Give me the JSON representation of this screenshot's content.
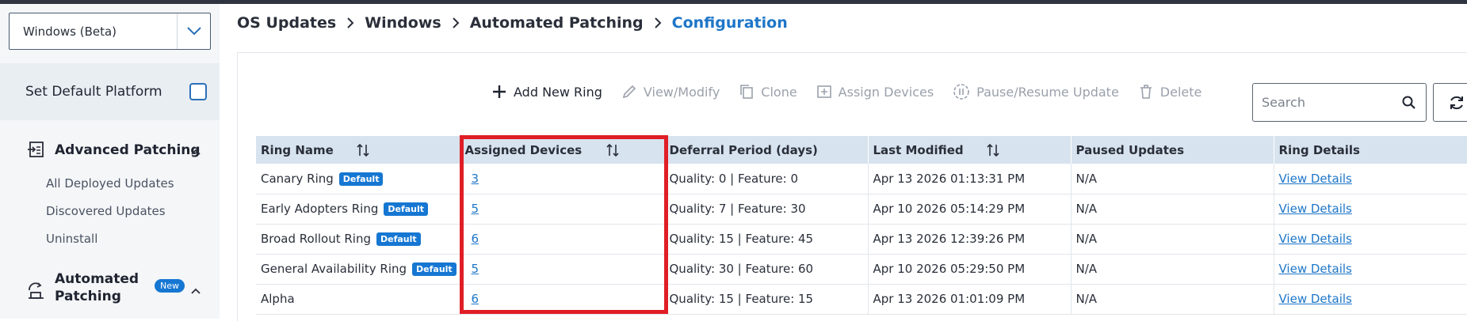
{
  "sidebar": {
    "platform_select": "Windows (Beta)",
    "default_platform_label": "Set Default Platform",
    "advanced": {
      "title": "Advanced Patching",
      "items": [
        "All Deployed Updates",
        "Discovered Updates",
        "Uninstall"
      ]
    },
    "automated": {
      "title_line1": "Automated",
      "title_line2": "Patching",
      "badge": "New"
    }
  },
  "breadcrumb": [
    "OS Updates",
    "Windows",
    "Automated Patching",
    "Configuration"
  ],
  "toolbar": {
    "add": "Add New Ring",
    "view": "View/Modify",
    "clone": "Clone",
    "assign": "Assign Devices",
    "pause": "Pause/Resume Update",
    "delete": "Delete",
    "search_placeholder": "Search"
  },
  "table": {
    "headers": [
      "Ring Name",
      "Assigned Devices",
      "Deferral Period (days)",
      "Last Modified",
      "Paused Updates",
      "Ring Details"
    ],
    "default_badge": "Default",
    "rows": [
      {
        "name": "Canary Ring",
        "devices": "3",
        "deferral": "Quality: 0 | Feature: 0",
        "modified": "Apr 13 2026 01:13:31 PM",
        "paused": "N/A",
        "details": "View Details"
      },
      {
        "name": "Early Adopters Ring",
        "devices": "5",
        "deferral": "Quality: 7 | Feature: 30",
        "modified": "Apr 10 2026 05:14:29 PM",
        "paused": "N/A",
        "details": "View Details"
      },
      {
        "name": "Broad Rollout Ring",
        "devices": "6",
        "deferral": "Quality: 15 | Feature: 45",
        "modified": "Apr 13 2026 12:39:26 PM",
        "paused": "N/A",
        "details": "View Details"
      },
      {
        "name": "General Availability Ring",
        "devices": "5",
        "deferral": "Quality: 30 | Feature: 60",
        "modified": "Apr 10 2026 05:29:50 PM",
        "paused": "N/A",
        "details": "View Details"
      },
      {
        "name": "Alpha",
        "devices": "6",
        "deferral": "Quality: 15 | Feature: 15",
        "modified": "Apr 13 2026 01:01:09 PM",
        "paused": "N/A",
        "details": "View Details"
      }
    ]
  },
  "colors": {
    "accent": "#1e76c8",
    "highlight": "#e01e26",
    "header_bg": "#d7e3ee"
  }
}
